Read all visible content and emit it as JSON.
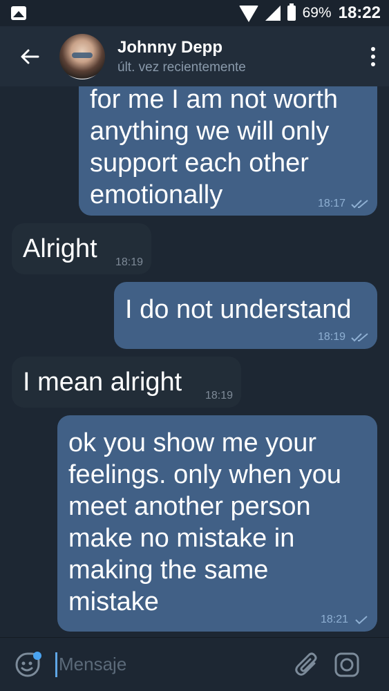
{
  "status_bar": {
    "battery": "69%",
    "time": "18:22"
  },
  "header": {
    "contact_name": "Johnny Depp",
    "contact_status": "últ. vez recientemente"
  },
  "messages": [
    {
      "direction": "out",
      "text": "for me I am not worth\nanything we will only\nsupport each other\nemotionally",
      "time": "18:17",
      "status": "read"
    },
    {
      "direction": "in",
      "text": "Alright",
      "time": "18:19"
    },
    {
      "direction": "out",
      "text": "I do not understand",
      "time": "18:19",
      "status": "read"
    },
    {
      "direction": "in",
      "text": "I mean alright",
      "time": "18:19"
    },
    {
      "direction": "out",
      "text": "ok you show me your\nfeelings. only when you\nmeet another person\nmake no mistake in\nmaking the same\nmistake",
      "time": "18:21",
      "status": "sent"
    }
  ],
  "input": {
    "placeholder": "Mensaje"
  },
  "colors": {
    "background": "#1d2733",
    "outgoing_bubble": "#416086",
    "incoming_bubble": "#222d38",
    "header": "#222d3a",
    "accent": "#4aa3f0"
  }
}
